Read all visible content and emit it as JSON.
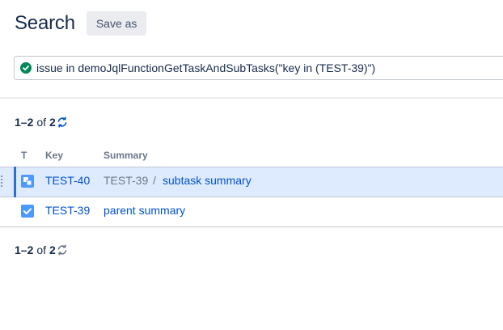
{
  "header": {
    "title": "Search",
    "save_as_label": "Save as"
  },
  "jql": {
    "query": "issue in demoJqlFunctionGetTaskAndSubTasks(\"key in (TEST-39)\")",
    "status_icon": "check-circle-icon",
    "status_color": "#00875a"
  },
  "pagination": {
    "range": "1–2",
    "of_label": "of",
    "total": "2"
  },
  "table": {
    "columns": [
      "T",
      "Key",
      "Summary"
    ],
    "rows": [
      {
        "type_icon": "subtask-icon",
        "key": "TEST-40",
        "parent_key": "TEST-39",
        "separator": "/",
        "summary": "subtask summary",
        "selected": true
      },
      {
        "type_icon": "task-icon",
        "key": "TEST-39",
        "summary": "parent summary",
        "selected": false
      }
    ]
  },
  "colors": {
    "link": "#0052cc",
    "selected_row_bg": "#deebff",
    "selected_indicator": "#2f6fd0",
    "issue_type_blue": "#4c9aff",
    "muted_text": "#6b778c"
  }
}
